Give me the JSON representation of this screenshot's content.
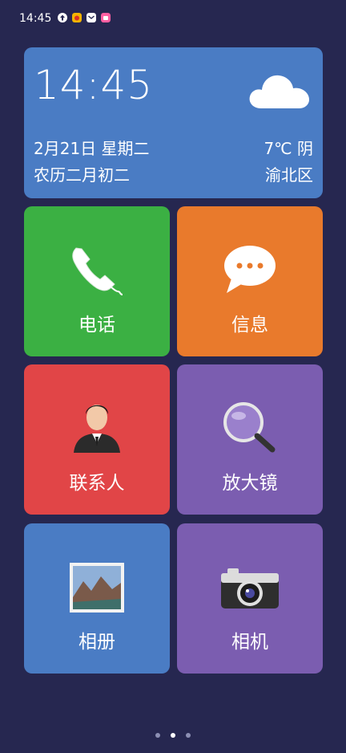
{
  "status_bar": {
    "time": "14:45",
    "icons": [
      {
        "name": "upload-icon",
        "color": "#ffffff"
      },
      {
        "name": "app-notification-icon",
        "color": "#f4b400"
      },
      {
        "name": "mail-icon",
        "color": "#ffffff"
      },
      {
        "name": "shop-app-icon",
        "color": "#ff5fa2"
      }
    ]
  },
  "clock_widget": {
    "time": "14:45",
    "date": "2月21日 星期二",
    "lunar_date": "农历二月初二",
    "weather": "7℃ 阴",
    "city": "渝北区",
    "weather_icon": "cloud-icon"
  },
  "apps": [
    {
      "label": "电话",
      "icon": "phone-icon",
      "color": "#3bb043"
    },
    {
      "label": "信息",
      "icon": "message-icon",
      "color": "#e97a2c"
    },
    {
      "label": "联系人",
      "icon": "contact-person-icon",
      "color": "#e14547"
    },
    {
      "label": "放大镜",
      "icon": "magnifier-icon",
      "color": "#7b5db0"
    },
    {
      "label": "相册",
      "icon": "photo-album-icon",
      "color": "#4a7cc4"
    },
    {
      "label": "相机",
      "icon": "camera-icon",
      "color": "#7b5db0"
    }
  ],
  "pager": {
    "pages": 3,
    "current": 2
  }
}
